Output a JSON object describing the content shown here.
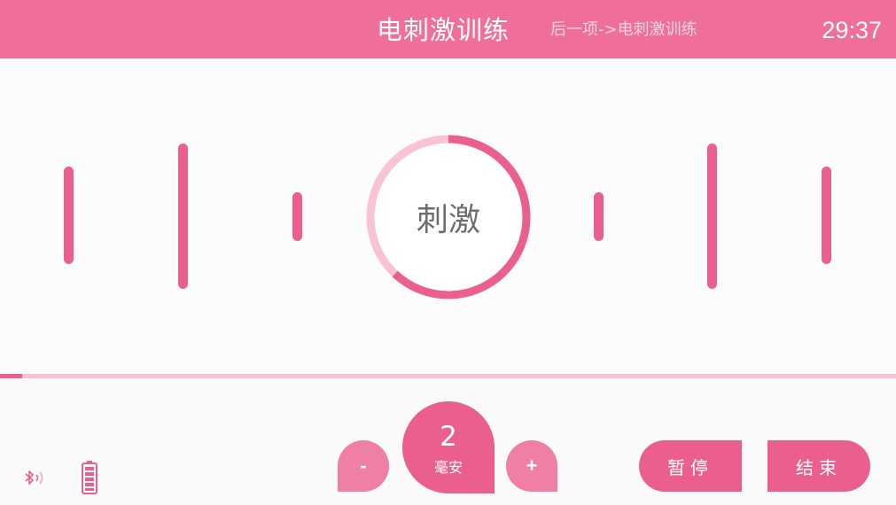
{
  "header": {
    "title": "电刺激训练",
    "next_item": "后一项->电刺激训练",
    "timer": "29:37"
  },
  "stimulus": {
    "center_label": "刺激",
    "ring_progress": 0.62
  },
  "session_progress": 0.025,
  "current": {
    "value": "2",
    "unit": "毫安",
    "decrease_label": "-",
    "increase_label": "+"
  },
  "actions": {
    "pause_label": "暂停",
    "end_label": "结束"
  },
  "status": {
    "bluetooth_icon": "bluetooth-icon",
    "battery_icon": "battery-icon",
    "battery_level": 1.0
  },
  "colors": {
    "accent": "#eb5f8f",
    "header": "#ef6f98",
    "light_accent": "#f9bfd2"
  }
}
